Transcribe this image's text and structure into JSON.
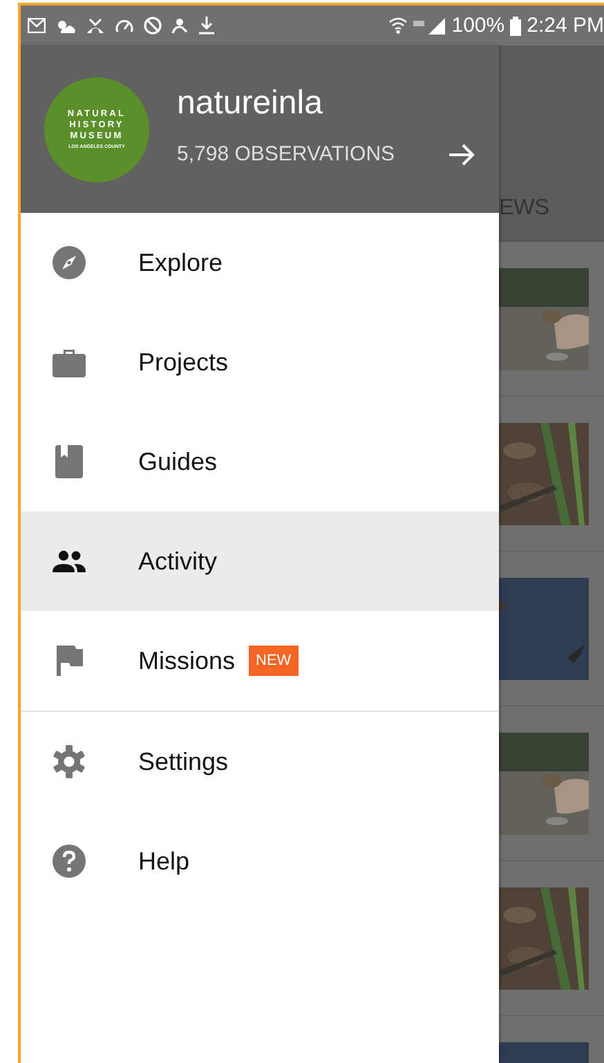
{
  "status_bar": {
    "battery": "100%",
    "time": "2:24 PM"
  },
  "drawer": {
    "logo": {
      "lines": [
        "NATURAL",
        "HISTORY",
        "MUSEUM"
      ],
      "subline": "LOS ANGELES COUNTY"
    },
    "username": "natureinla",
    "observations": "5,798 OBSERVATIONS",
    "sections": [
      [
        {
          "label": "Explore",
          "selected": false
        },
        {
          "label": "Projects",
          "selected": false
        },
        {
          "label": "Guides",
          "selected": false
        },
        {
          "label": "Activity",
          "selected": true
        },
        {
          "label": "Missions",
          "selected": false,
          "badge": "NEW"
        }
      ],
      [
        {
          "label": "Settings",
          "selected": false
        },
        {
          "label": "Help",
          "selected": false
        }
      ]
    ]
  },
  "background": {
    "tab": "EWS"
  }
}
